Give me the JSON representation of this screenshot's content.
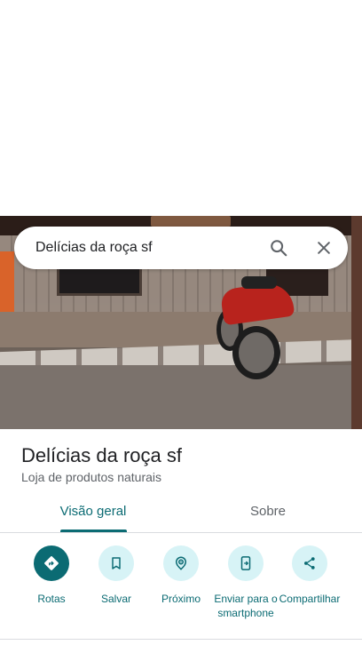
{
  "search": {
    "query": "Delícias da roça sf",
    "search_icon": "search-icon",
    "close_icon": "close-icon"
  },
  "place": {
    "name": "Delícias da roça sf",
    "category": "Loja de produtos naturais"
  },
  "tabs": [
    {
      "label": "Visão geral",
      "selected": true
    },
    {
      "label": "Sobre",
      "selected": false
    }
  ],
  "actions": [
    {
      "label": "Rotas",
      "icon": "directions-icon"
    },
    {
      "label": "Salvar",
      "icon": "bookmark-icon"
    },
    {
      "label": "Próximo",
      "icon": "nearby-icon"
    },
    {
      "label": "Enviar para o smartphone",
      "icon": "send-to-phone-icon"
    },
    {
      "label": "Compartilhar",
      "icon": "share-icon"
    }
  ],
  "colors": {
    "accent": "#0b6b73",
    "action_bg": "#d7f3f6",
    "text": "#202124",
    "secondary_text": "#5f6368"
  }
}
